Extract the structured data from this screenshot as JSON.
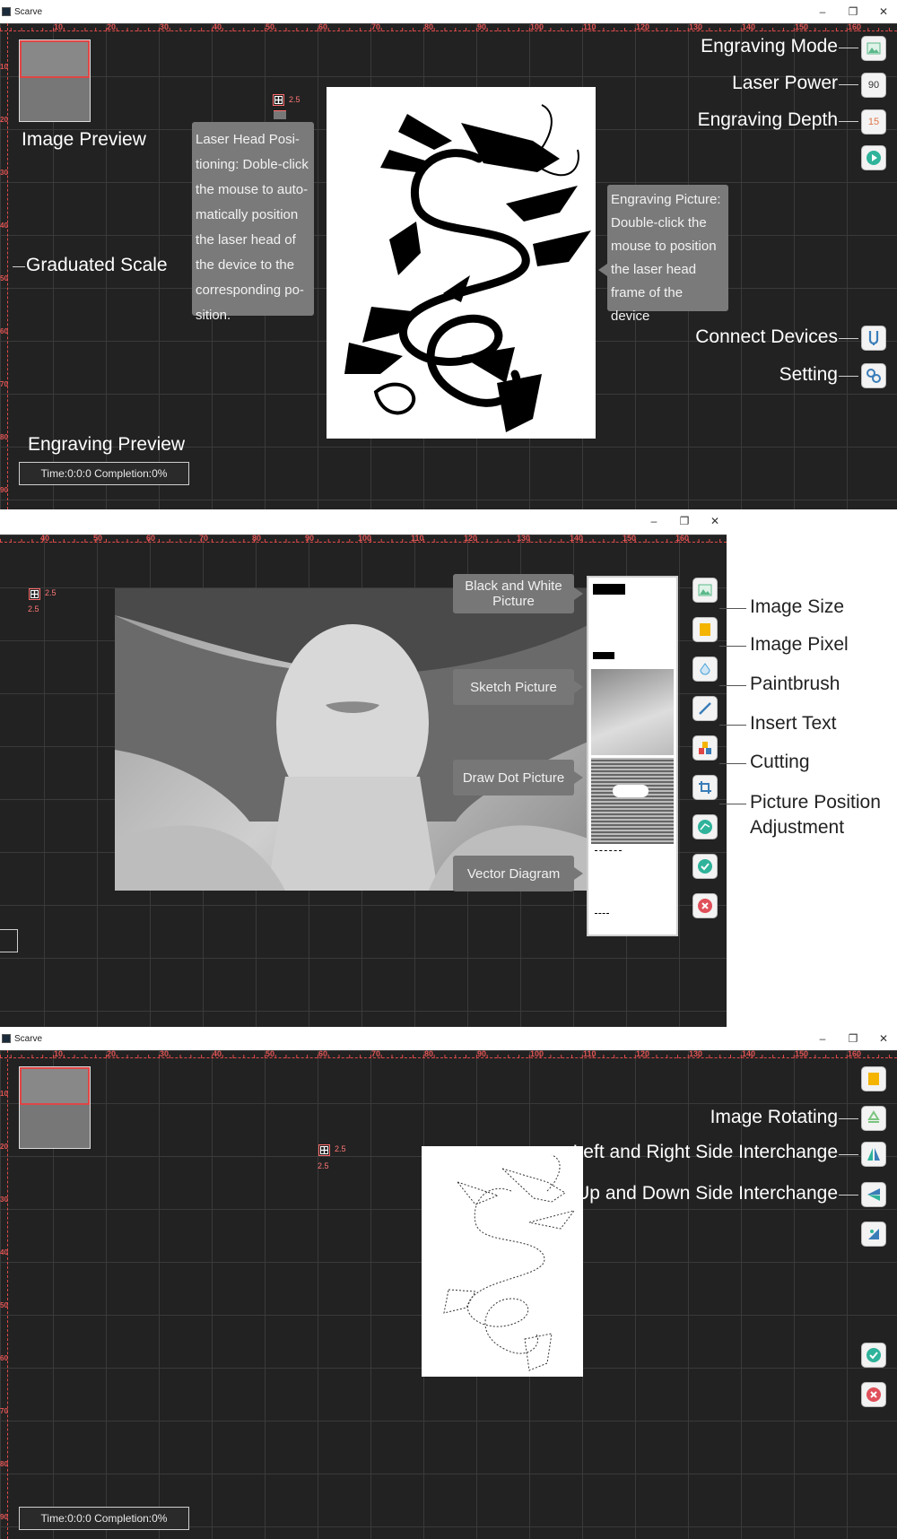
{
  "app": {
    "title": "Scarve",
    "win_min": "–",
    "win_restore": "❐",
    "win_close": "✕"
  },
  "ruler": {
    "x_ticks": [
      "10",
      "20",
      "30",
      "40",
      "50",
      "60",
      "70",
      "80",
      "90",
      "100",
      "110",
      "120",
      "130",
      "140",
      "150",
      "160"
    ],
    "y_ticks": [
      "10",
      "20",
      "30",
      "40",
      "50",
      "60",
      "70",
      "80",
      "90"
    ],
    "x_ticks2": [
      "40",
      "50",
      "60",
      "70",
      "80",
      "90",
      "100",
      "110",
      "120",
      "130",
      "140",
      "150",
      "160"
    ]
  },
  "panel1": {
    "labels": {
      "engraving_mode": "Engraving Mode",
      "laser_power": "Laser Power",
      "engraving_depth": "Engraving Depth",
      "connect_devices": "Connect Devices",
      "setting": "Setting",
      "image_preview": "Image Preview",
      "graduated_scale": "Graduated Scale",
      "engraving_preview": "Engraving Preview"
    },
    "buttons": {
      "power_value": "90",
      "depth_value": "15"
    },
    "callout_left": "Laser Head Posi-tioning: Doble-click the mouse to auto-matically position the laser head of the device to the corresponding po-sition.",
    "callout_right": "Engraving Picture: Double-click the mouse to position the laser head frame of the device",
    "marker_value": "2.5",
    "status": "Time:0:0:0  Completion:0%"
  },
  "panel2": {
    "styles": {
      "bw": "Black and White Picture",
      "sketch": "Sketch Picture",
      "dot": "Draw Dot Picture",
      "vector": "Vector Diagram"
    },
    "labels": {
      "image_size": "Image Size",
      "image_pixel": "Image Pixel",
      "paintbrush": "Paintbrush",
      "insert_text": "Insert Text",
      "cutting": "Cutting",
      "position_adj_1": "Picture Position",
      "position_adj_2": "Adjustment"
    },
    "marker_value": "2.5",
    "marker_value2": "2.5"
  },
  "panel3": {
    "labels": {
      "image_rotating": "Image Rotating",
      "lr_interchange": "Left and Right Side Interchange",
      "ud_interchange": "Up and Down Side Interchange"
    },
    "marker_value": "2.5",
    "marker_value2": "2.5",
    "status": "Time:0:0:0  Completion:0%"
  },
  "colors": {
    "canvas": "#222222",
    "ruler": "#e24a4a",
    "callout": "#7a7a7a",
    "accept": "#2fb39b",
    "cancel": "#e0505a"
  }
}
